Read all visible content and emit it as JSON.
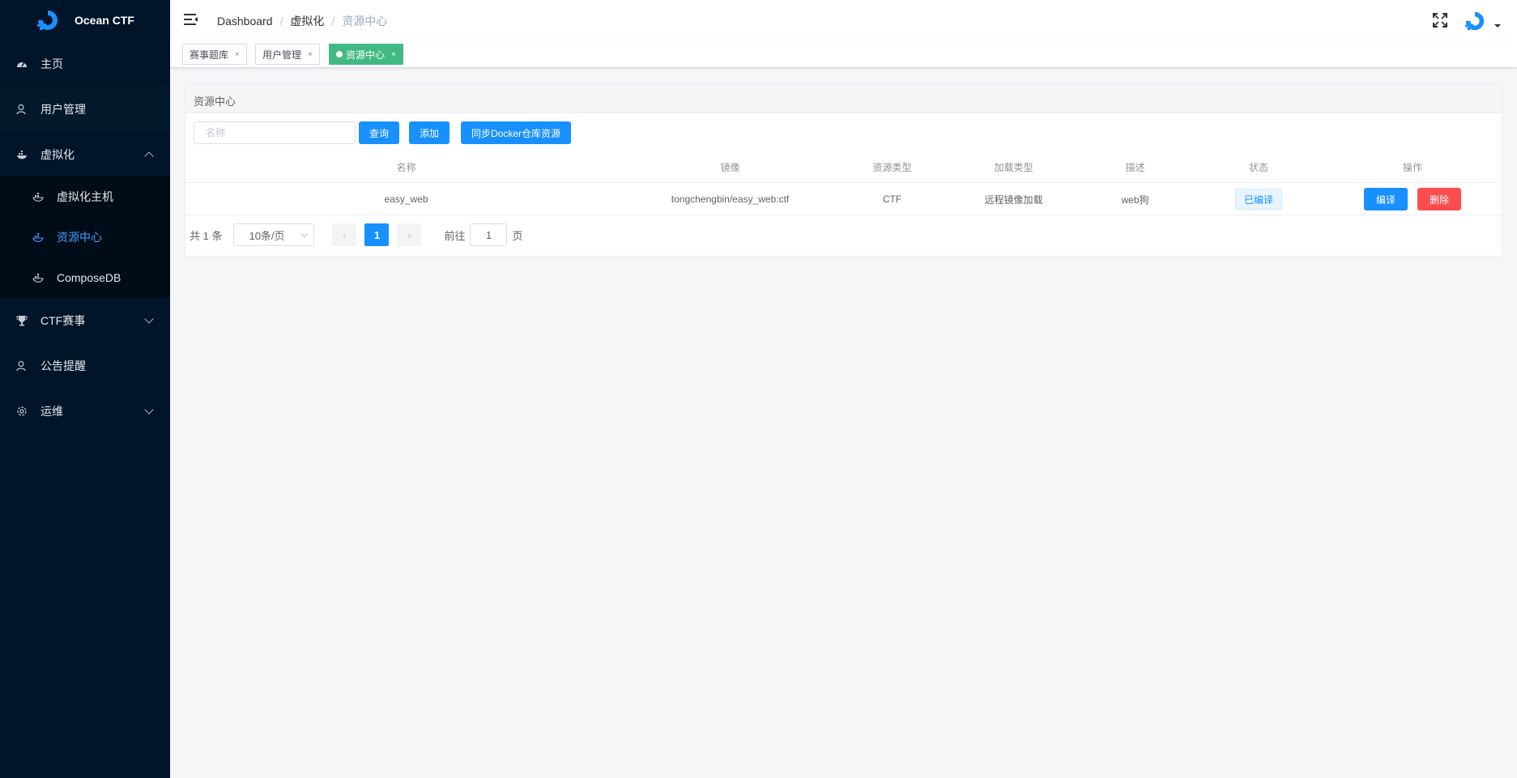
{
  "app": {
    "name": "Ocean CTF"
  },
  "sidebar": {
    "items": [
      {
        "label": "主页"
      },
      {
        "label": "用户管理"
      },
      {
        "label": "虚拟化"
      },
      {
        "label": "CTF赛事"
      },
      {
        "label": "公告提醒"
      },
      {
        "label": "运维"
      }
    ],
    "submenu": [
      {
        "label": "虚拟化主机"
      },
      {
        "label": "资源中心"
      },
      {
        "label": "ComposeDB"
      }
    ]
  },
  "header": {
    "breadcrumb": [
      "Dashboard",
      "虚拟化",
      "资源中心"
    ],
    "separator": "/"
  },
  "tags": [
    {
      "label": "赛事题库"
    },
    {
      "label": "用户管理"
    },
    {
      "label": "资源中心"
    }
  ],
  "tag_close": "×",
  "card": {
    "title": "资源中心",
    "search_placeholder": "名称",
    "query_label": "查询",
    "add_label": "添加",
    "sync_label": "同步Docker仓库资源"
  },
  "table": {
    "columns": [
      "名称",
      "镜像",
      "资源类型",
      "加载类型",
      "描述",
      "状态",
      "操作"
    ],
    "rows": [
      {
        "name": "easy_web",
        "image": "tongchengbin/easy_web:ctf",
        "type": "CTF",
        "load": "远程镜像加载",
        "desc": "web狗",
        "status": "已编译",
        "edit": "编译",
        "delete": "删除"
      }
    ]
  },
  "pagination": {
    "total_text": "共 1 条",
    "page_size": "10条/页",
    "current": "1",
    "goto_prefix": "前往",
    "goto_value": "1",
    "goto_suffix": "页",
    "prev": "‹",
    "next": "›"
  }
}
